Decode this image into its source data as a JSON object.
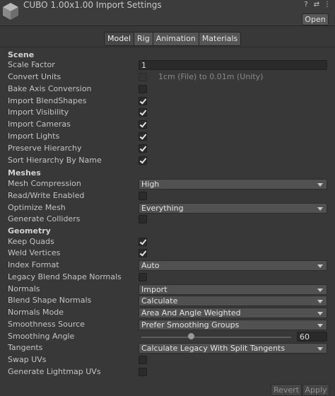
{
  "header": {
    "title": "CUBO 1.00x1.00 Import Settings",
    "open_label": "Open",
    "icons": [
      "help-icon",
      "preset-icon",
      "overflow-menu-icon"
    ]
  },
  "tabs": [
    {
      "label": "Model",
      "active": true
    },
    {
      "label": "Rig",
      "active": false
    },
    {
      "label": "Animation",
      "active": false
    },
    {
      "label": "Materials",
      "active": false
    }
  ],
  "scene": {
    "heading": "Scene",
    "scale_factor_label": "Scale Factor",
    "scale_factor_value": "1",
    "convert_units_label": "Convert Units",
    "convert_units_note": "1cm (File) to 0.01m (Unity)",
    "bake_axis_label": "Bake Axis Conversion",
    "import_blendshapes_label": "Import BlendShapes",
    "import_visibility_label": "Import Visibility",
    "import_cameras_label": "Import Cameras",
    "import_lights_label": "Import Lights",
    "preserve_hierarchy_label": "Preserve Hierarchy",
    "sort_hierarchy_label": "Sort Hierarchy By Name"
  },
  "meshes": {
    "heading": "Meshes",
    "mesh_compression_label": "Mesh Compression",
    "mesh_compression_value": "High",
    "read_write_label": "Read/Write Enabled",
    "optimize_mesh_label": "Optimize Mesh",
    "optimize_mesh_value": "Everything",
    "generate_colliders_label": "Generate Colliders"
  },
  "geometry": {
    "heading": "Geometry",
    "keep_quads_label": "Keep Quads",
    "weld_vertices_label": "Weld Vertices",
    "index_format_label": "Index Format",
    "index_format_value": "Auto",
    "legacy_blend_label": "Legacy Blend Shape Normals",
    "normals_label": "Normals",
    "normals_value": "Import",
    "blend_shape_normals_label": "Blend Shape Normals",
    "blend_shape_normals_value": "Calculate",
    "normals_mode_label": "Normals Mode",
    "normals_mode_value": "Area And Angle Weighted",
    "smoothness_source_label": "Smoothness Source",
    "smoothness_source_value": "Prefer Smoothing Groups",
    "smoothing_angle_label": "Smoothing Angle",
    "smoothing_angle_value": "60",
    "smoothing_angle_fraction": 0.333,
    "tangents_label": "Tangents",
    "tangents_value": "Calculate Legacy With Split Tangents",
    "swap_uvs_label": "Swap UVs",
    "lightmap_uvs_label": "Generate Lightmap UVs"
  },
  "footer": {
    "revert_label": "Revert",
    "apply_label": "Apply"
  }
}
